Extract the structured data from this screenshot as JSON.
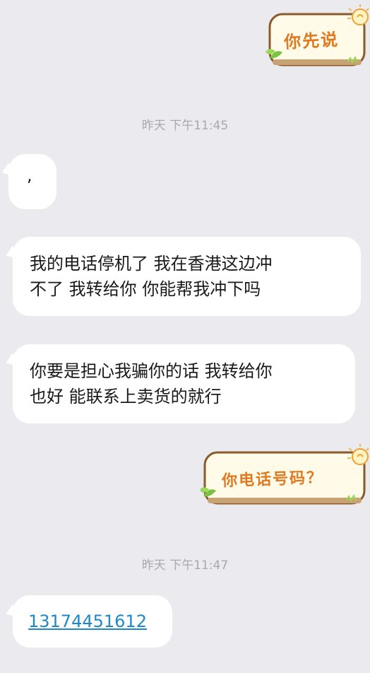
{
  "messages": {
    "sticker_1": {
      "text": "你先说"
    },
    "timestamp_1": "昨天 下午11:45",
    "msg_1": ",",
    "msg_2": "我的电话停机了  我在香港这边冲\n不了  我转给你  你能帮我冲下吗",
    "msg_3": "你要是担心我骗你的话 我转给你\n也好 能联系上卖货的就行",
    "sticker_2": {
      "text": "你电话号码？"
    },
    "timestamp_2": "昨天 下午11:47",
    "msg_4": "13174451612"
  },
  "colors": {
    "background": "#ebebef",
    "bubble": "#ffffff",
    "link": "#1e88c8",
    "sticker_text": "#e07a22",
    "sticker_border": "#8a5a2b"
  }
}
